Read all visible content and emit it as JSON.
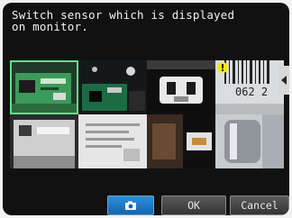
{
  "prompt": {
    "line1": "Switch sensor which is displayed",
    "line2": "on monitor."
  },
  "thumbnails": [
    {
      "name": "green-pcb-sensor",
      "selected": true
    },
    {
      "name": "circuit-board"
    },
    {
      "name": "connector-part"
    },
    {
      "name": "barcode-label",
      "warning": true
    },
    {
      "name": "metal-bracket"
    },
    {
      "name": "printed-label"
    },
    {
      "name": "dark-component"
    },
    {
      "name": "metal-tube"
    }
  ],
  "buttons": {
    "camera_icon": "camera-icon",
    "ok": "OK",
    "cancel": "Cancel"
  },
  "barcode_text": "062 2",
  "colors": {
    "selection": "#5fe08a",
    "camera_button": "#1f7acb",
    "warning": "#ffe600"
  }
}
